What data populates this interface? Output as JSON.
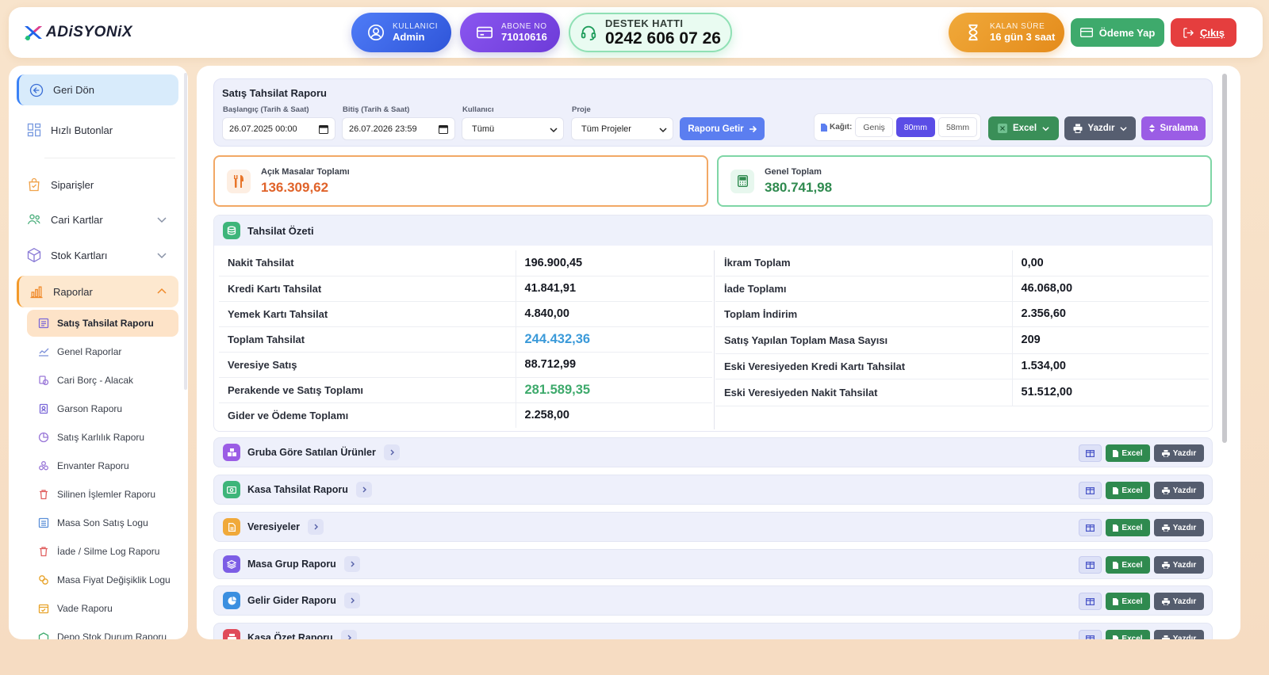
{
  "brand": {
    "name": "ADiSYONiX"
  },
  "header": {
    "user": {
      "label": "KULLANICI",
      "value": "Admin"
    },
    "abone": {
      "label": "ABONE NO",
      "value": "71010616"
    },
    "destek": {
      "label": "DESTEK HATTI",
      "value": "0242 606 07 26"
    },
    "kalan": {
      "label": "KALAN SÜRE",
      "value": "16 gün 3 saat"
    },
    "odeme_label": "Ödeme Yap",
    "cikis_label": "Çıkış"
  },
  "sidebar": {
    "back": "Geri Dön",
    "hizli": "Hızlı Butonlar",
    "siparisler": "Siparişler",
    "cari": "Cari Kartlar",
    "stok": "Stok Kartları",
    "raporlar": "Raporlar",
    "sub": [
      "Satış Tahsilat Raporu",
      "Genel Raporlar",
      "Cari Borç - Alacak",
      "Garson Raporu",
      "Satış Karlılık Raporu",
      "Envanter Raporu",
      "Silinen İşlemler Raporu",
      "Masa Son Satış Logu",
      "İade / Silme Log Raporu",
      "Masa Fiyat Değişiklik Logu",
      "Vade Raporu",
      "Depo Stok Durum Raporu"
    ]
  },
  "filter": {
    "title": "Satış Tahsilat Raporu",
    "start_label": "Başlangıç (Tarih & Saat)",
    "start_value": "26.07.2025 00:00",
    "end_label": "Bitiş (Tarih & Saat)",
    "end_value": "26.07.2026 23:59",
    "user_label": "Kullanıcı",
    "user_value": "Tümü",
    "proje_label": "Proje",
    "proje_value": "Tüm Projeler",
    "getir": "Raporu Getir",
    "kagit_label": "Kağıt:",
    "kagit": [
      "Geniş",
      "80mm",
      "58mm"
    ],
    "excel": "Excel",
    "yazdir": "Yazdır",
    "siralama": "Sıralama"
  },
  "cards": {
    "acik": {
      "label": "Açık Masalar Toplamı",
      "value": "136.309,62"
    },
    "genel": {
      "label": "Genel Toplam",
      "value": "380.741,98"
    }
  },
  "tahsilat": {
    "title": "Tahsilat Özeti",
    "left": [
      {
        "k": "Nakit Tahsilat",
        "v": "196.900,45"
      },
      {
        "k": "Kredi Kartı Tahsilat",
        "v": "41.841,91"
      },
      {
        "k": "Yemek Kartı Tahsilat",
        "v": "4.840,00"
      },
      {
        "k": "Toplam Tahsilat",
        "v": "244.432,36"
      },
      {
        "k": "Veresiye Satış",
        "v": "88.712,99"
      },
      {
        "k": "Perakende ve Satış Toplamı",
        "v": "281.589,35"
      },
      {
        "k": "Gider ve Ödeme Toplamı",
        "v": "2.258,00"
      }
    ],
    "right": [
      {
        "k": "İkram Toplam",
        "v": "0,00"
      },
      {
        "k": "İade Toplamı",
        "v": "46.068,00"
      },
      {
        "k": "Toplam İndirim",
        "v": "2.356,60"
      },
      {
        "k": "Satış Yapılan Toplam Masa Sayısı",
        "v": "209"
      },
      {
        "k": "Eski Veresiyeden Kredi Kartı Tahsilat",
        "v": "1.534,00"
      },
      {
        "k": "Eski Veresiyeden Nakit Tahsilat",
        "v": "51.512,00"
      }
    ]
  },
  "sections": {
    "btn_excel": "Excel",
    "btn_yazdir": "Yazdır",
    "items": [
      "Gruba Göre Satılan Ürünler",
      "Kasa Tahsilat Raporu",
      "Veresiyeler",
      "Masa Grup Raporu",
      "Gelir Gider Raporu",
      "Kasa Özet Raporu"
    ]
  },
  "colors": {
    "accent": "#5b7ef0",
    "orange": "#e8752a",
    "green": "#2f8a4f",
    "blue_value": "#3b9ad9",
    "green_value": "#3eaa6c"
  }
}
